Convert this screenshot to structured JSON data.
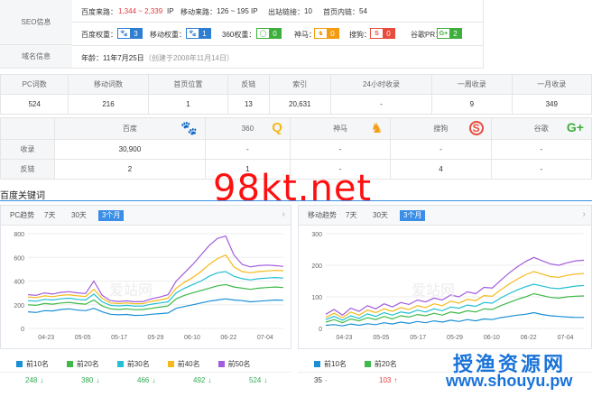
{
  "seo": {
    "label": "SEO信息",
    "baidu_traffic_label": "百度来路：",
    "baidu_traffic_value": "1,344 ~ 2,339",
    "baidu_traffic_unit": "IP",
    "mobile_traffic_label": "移动来路：",
    "mobile_traffic_value": "126 ~ 195 IP",
    "outlinks_label": "出站链接：",
    "outlinks_value": "10",
    "homepage_inlinks_label": "首页内链：",
    "homepage_inlinks_value": "54",
    "weights": [
      {
        "label": "百度权重：",
        "value": "3",
        "icon": "paw-icon",
        "color": "#2f7fd1"
      },
      {
        "label": "移动权重：",
        "value": "1",
        "icon": "paw-icon",
        "color": "#2f7fd1"
      },
      {
        "label": "360权重：",
        "value": "0",
        "icon": "360-icon",
        "color": "#3eaf3c"
      },
      {
        "label": "神马：",
        "value": "0",
        "icon": "shenma-icon",
        "color": "#f39c12"
      },
      {
        "label": "搜狗：",
        "value": "0",
        "icon": "sogou-icon",
        "color": "#e74c3c"
      },
      {
        "label": "谷歌PR：",
        "value": "2",
        "icon": "google-icon",
        "color": "#3eaf3c"
      }
    ]
  },
  "domain": {
    "label": "域名信息",
    "age_label": "年龄：",
    "age_value": "11年7月25日",
    "created": "（创建于2008年11月14日）"
  },
  "stats_table": {
    "headers": [
      "PC词数",
      "移动词数",
      "首页位置",
      "反链",
      "索引",
      "24小时收录",
      "一周收录",
      "一月收录"
    ],
    "values": [
      "524",
      "216",
      "1",
      "13",
      "20,631",
      "-",
      "9",
      "349"
    ]
  },
  "engine_table": {
    "engines": [
      "百度",
      "360",
      "神马",
      "搜狗",
      "谷歌"
    ],
    "rows": [
      {
        "label": "收录",
        "values": [
          "30,900",
          "-",
          "-",
          "-",
          "-"
        ]
      },
      {
        "label": "反链",
        "values": [
          "2",
          "1",
          "-",
          "4",
          "-"
        ]
      }
    ]
  },
  "watermark": "98kt.net",
  "section_title": "百度关键词",
  "pc_panel": {
    "title": "PC趋势",
    "tabs": [
      "7天",
      "30天",
      "3个月"
    ],
    "watermark": "爱站网"
  },
  "mobile_panel": {
    "title": "移动趋势",
    "tabs": [
      "7天",
      "30天",
      "3个月"
    ],
    "watermark": "爱站网"
  },
  "pc_legend": [
    {
      "label": "前10名",
      "color": "#1b8fd6"
    },
    {
      "label": "前20名",
      "color": "#3eb94a"
    },
    {
      "label": "前30名",
      "color": "#22c0d2"
    },
    {
      "label": "前40名",
      "color": "#f4b919"
    },
    {
      "label": "前50名",
      "color": "#a25ddc"
    }
  ],
  "pc_values": [
    {
      "value": "248",
      "trend": "down"
    },
    {
      "value": "380",
      "trend": "down"
    },
    {
      "value": "466",
      "trend": "down"
    },
    {
      "value": "492",
      "trend": "down"
    },
    {
      "value": "524",
      "trend": "down"
    }
  ],
  "mobile_legend": [
    {
      "label": "前10名",
      "color": "#1b8fd6"
    },
    {
      "label": "前20名",
      "color": "#3eb94a"
    }
  ],
  "mobile_values": [
    {
      "value": "35",
      "trend": "-"
    },
    {
      "value": "103",
      "trend": "up"
    }
  ],
  "footer_watermark": "授渔资源网",
  "footer_url": "www.shouyu.pw",
  "chart_data": [
    {
      "type": "line",
      "title": "PC趋势",
      "x_ticks": [
        "04-23",
        "05-05",
        "05-17",
        "05-29",
        "06-10",
        "06-22",
        "07-04"
      ],
      "y_ticks": [
        0,
        200,
        400,
        600,
        800
      ],
      "ylim": [
        0,
        800
      ],
      "series": [
        {
          "name": "前10名",
          "color": "#1b8fd6",
          "values": [
            140,
            135,
            150,
            148,
            160,
            165,
            155,
            150,
            170,
            140,
            120,
            115,
            118,
            110,
            112,
            120,
            125,
            130,
            170,
            185,
            200,
            215,
            230,
            240,
            250,
            240,
            235,
            225,
            230,
            235,
            240,
            238
          ]
        },
        {
          "name": "前20名",
          "color": "#3eb94a",
          "values": [
            200,
            195,
            210,
            205,
            215,
            220,
            210,
            205,
            240,
            190,
            165,
            160,
            165,
            158,
            160,
            170,
            180,
            190,
            250,
            280,
            300,
            320,
            340,
            360,
            370,
            350,
            340,
            330,
            340,
            345,
            350,
            345
          ]
        },
        {
          "name": "前30名",
          "color": "#22c0d2",
          "values": [
            235,
            230,
            245,
            240,
            250,
            255,
            245,
            240,
            290,
            225,
            195,
            190,
            195,
            188,
            190,
            205,
            215,
            225,
            300,
            340,
            370,
            400,
            440,
            470,
            480,
            440,
            420,
            410,
            420,
            425,
            430,
            425
          ]
        },
        {
          "name": "前40名",
          "color": "#f4b919",
          "values": [
            265,
            260,
            275,
            268,
            280,
            285,
            275,
            270,
            330,
            255,
            215,
            210,
            215,
            208,
            210,
            228,
            240,
            255,
            340,
            390,
            430,
            480,
            540,
            590,
            620,
            520,
            480,
            470,
            480,
            485,
            490,
            488
          ]
        },
        {
          "name": "前50名",
          "color": "#a25ddc",
          "values": [
            285,
            280,
            300,
            290,
            305,
            310,
            300,
            295,
            400,
            280,
            235,
            228,
            232,
            225,
            228,
            250,
            265,
            285,
            400,
            470,
            540,
            620,
            700,
            760,
            780,
            620,
            540,
            520,
            530,
            535,
            530,
            524
          ]
        }
      ]
    },
    {
      "type": "line",
      "title": "移动趋势",
      "x_ticks": [
        "04-23",
        "05-05",
        "05-17",
        "05-29",
        "06-10",
        "06-22",
        "07-04"
      ],
      "y_ticks": [
        0,
        100,
        200,
        300
      ],
      "ylim": [
        0,
        300
      ],
      "series": [
        {
          "name": "前10名",
          "color": "#1b8fd6",
          "values": [
            10,
            12,
            8,
            14,
            10,
            15,
            12,
            18,
            14,
            20,
            16,
            22,
            18,
            24,
            20,
            26,
            22,
            28,
            24,
            30,
            28,
            34,
            38,
            42,
            45,
            50,
            44,
            40,
            38,
            36,
            35,
            35
          ]
        },
        {
          "name": "前20名",
          "color": "#3eb94a",
          "values": [
            20,
            28,
            18,
            30,
            24,
            34,
            28,
            38,
            30,
            40,
            36,
            44,
            40,
            48,
            42,
            52,
            48,
            56,
            52,
            62,
            60,
            72,
            82,
            92,
            100,
            110,
            104,
            98,
            96,
            100,
            102,
            103
          ]
        },
        {
          "name": "前30名",
          "color": "#22c0d2",
          "values": [
            28,
            38,
            26,
            40,
            32,
            46,
            38,
            50,
            42,
            52,
            48,
            58,
            52,
            62,
            56,
            68,
            64,
            74,
            70,
            82,
            80,
            96,
            110,
            122,
            132,
            140,
            134,
            128,
            126,
            130,
            134,
            136
          ]
        },
        {
          "name": "前40名",
          "color": "#f4b919",
          "values": [
            35,
            48,
            34,
            52,
            42,
            58,
            50,
            62,
            54,
            66,
            60,
            72,
            66,
            78,
            72,
            86,
            80,
            92,
            88,
            104,
            102,
            122,
            140,
            156,
            170,
            180,
            172,
            164,
            162,
            168,
            172,
            174
          ]
        },
        {
          "name": "前50名",
          "color": "#a25ddc",
          "values": [
            45,
            60,
            42,
            64,
            54,
            72,
            62,
            78,
            68,
            82,
            76,
            90,
            84,
            96,
            90,
            106,
            100,
            116,
            110,
            130,
            128,
            152,
            175,
            195,
            212,
            225,
            214,
            204,
            200,
            208,
            214,
            216
          ]
        }
      ]
    }
  ]
}
